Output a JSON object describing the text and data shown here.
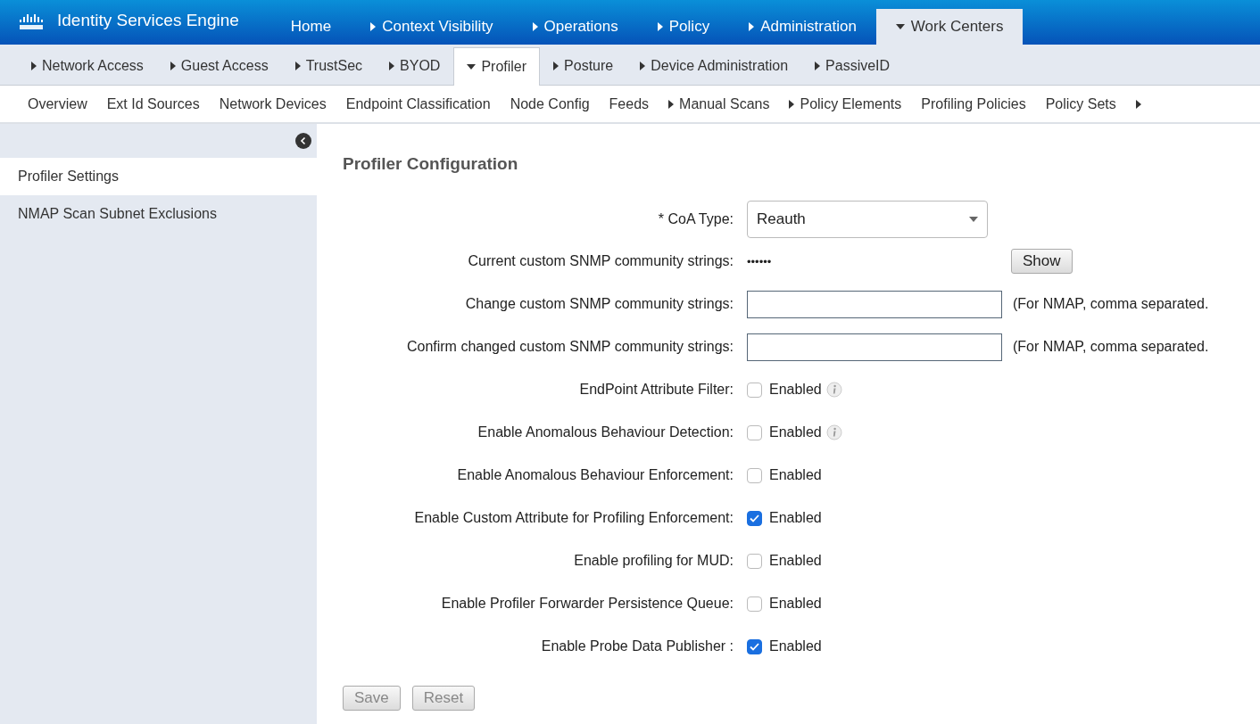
{
  "header": {
    "product": "Identity Services Engine",
    "tabs": [
      {
        "label": "Home",
        "has_submenu": false,
        "selected": false
      },
      {
        "label": "Context Visibility",
        "has_submenu": true,
        "selected": false
      },
      {
        "label": "Operations",
        "has_submenu": true,
        "selected": false
      },
      {
        "label": "Policy",
        "has_submenu": true,
        "selected": false
      },
      {
        "label": "Administration",
        "has_submenu": true,
        "selected": false
      },
      {
        "label": "Work Centers",
        "has_submenu": true,
        "selected": true
      }
    ]
  },
  "work_center_tabs": [
    {
      "label": "Network Access",
      "selected": false
    },
    {
      "label": "Guest Access",
      "selected": false
    },
    {
      "label": "TrustSec",
      "selected": false
    },
    {
      "label": "BYOD",
      "selected": false
    },
    {
      "label": "Profiler",
      "selected": true
    },
    {
      "label": "Posture",
      "selected": false
    },
    {
      "label": "Device Administration",
      "selected": false
    },
    {
      "label": "PassiveID",
      "selected": false
    }
  ],
  "profiler_menu": {
    "items": [
      {
        "label": "Overview",
        "has_submenu": false
      },
      {
        "label": "Ext Id Sources",
        "has_submenu": false
      },
      {
        "label": "Network Devices",
        "has_submenu": false
      },
      {
        "label": "Endpoint Classification",
        "has_submenu": false
      },
      {
        "label": "Node Config",
        "has_submenu": false
      },
      {
        "label": "Feeds",
        "has_submenu": false
      },
      {
        "label": "Manual Scans",
        "has_submenu": true
      },
      {
        "label": "Policy Elements",
        "has_submenu": true
      },
      {
        "label": "Profiling Policies",
        "has_submenu": false
      },
      {
        "label": "Policy Sets",
        "has_submenu": false
      }
    ],
    "more_arrow": true
  },
  "sidebar": {
    "items": [
      {
        "label": "Profiler Settings",
        "selected": true
      },
      {
        "label": "NMAP Scan Subnet Exclusions",
        "selected": false
      }
    ]
  },
  "form": {
    "title": "Profiler Configuration",
    "fields": [
      {
        "kind": "select",
        "label": "* CoA Type:",
        "value": "Reauth"
      },
      {
        "kind": "secret",
        "label": "Current custom SNMP community strings:",
        "value": "••••••",
        "button": "Show"
      },
      {
        "kind": "text",
        "label": "Change custom SNMP community strings:",
        "hint": "(For NMAP, comma separated."
      },
      {
        "kind": "text",
        "label": "Confirm changed custom SNMP community strings:",
        "hint": "(For NMAP, comma separated."
      },
      {
        "kind": "checkbox",
        "label": "EndPoint Attribute Filter:",
        "option": "Enabled",
        "checked": false,
        "info": true
      },
      {
        "kind": "checkbox",
        "label": "Enable Anomalous Behaviour Detection:",
        "option": "Enabled",
        "checked": false,
        "info": true
      },
      {
        "kind": "checkbox",
        "label": "Enable Anomalous Behaviour Enforcement:",
        "option": "Enabled",
        "checked": false,
        "info": false
      },
      {
        "kind": "checkbox",
        "label": "Enable Custom Attribute for Profiling Enforcement:",
        "option": "Enabled",
        "checked": true,
        "info": false
      },
      {
        "kind": "checkbox",
        "label": "Enable profiling for MUD:",
        "option": "Enabled",
        "checked": false,
        "info": false
      },
      {
        "kind": "checkbox",
        "label": "Enable Profiler Forwarder Persistence Queue:",
        "option": "Enabled",
        "checked": false,
        "info": false
      },
      {
        "kind": "checkbox",
        "label": "Enable Probe Data Publisher :",
        "option": "Enabled",
        "checked": true,
        "info": false
      }
    ],
    "buttons": [
      {
        "label": "Save",
        "disabled": true
      },
      {
        "label": "Reset",
        "disabled": true
      }
    ]
  }
}
